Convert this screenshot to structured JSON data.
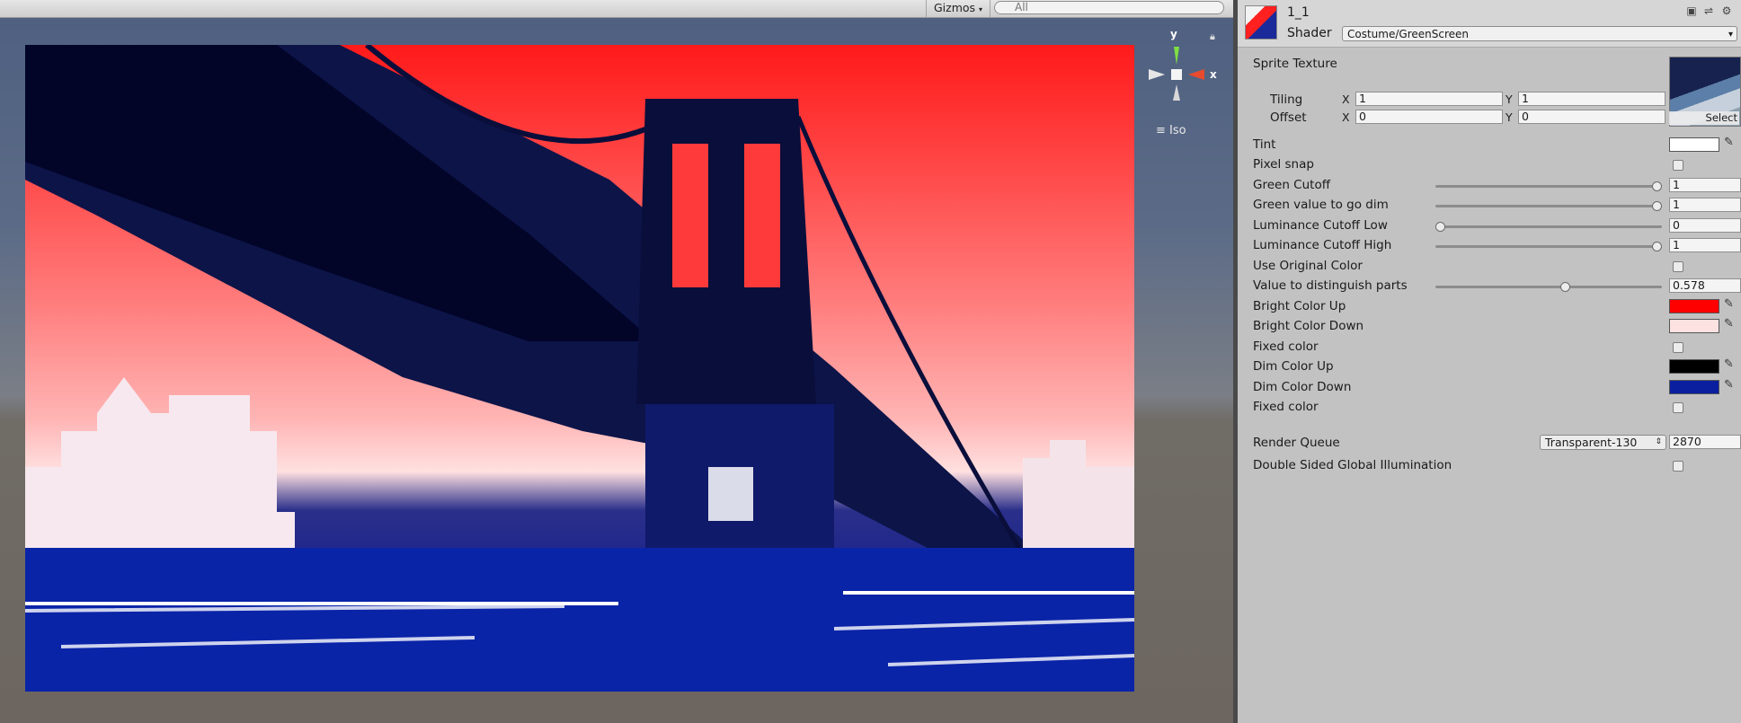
{
  "scene": {
    "gizmos_label": "Gizmos",
    "search_placeholder": "All",
    "axis_y": "y",
    "axis_x": "x",
    "iso_label": "Iso"
  },
  "inspector": {
    "material_name": "1_1",
    "shader_label": "Shader",
    "shader_value": "Costume/GreenScreen",
    "sprite_texture_label": "Sprite Texture",
    "texture_select_label": "Select",
    "tiling": {
      "label": "Tiling",
      "x_label": "X",
      "y_label": "Y",
      "x": "1",
      "y": "1"
    },
    "offset": {
      "label": "Offset",
      "x_label": "X",
      "y_label": "Y",
      "x": "0",
      "y": "0"
    },
    "tint_label": "Tint",
    "pixel_snap_label": "Pixel snap",
    "sliders": [
      {
        "label": "Green Cutoff",
        "value": "1",
        "fraction": 1.0
      },
      {
        "label": "Green value to go dim",
        "value": "1",
        "fraction": 1.0
      },
      {
        "label": "Luminance Cutoff Low",
        "value": "0",
        "fraction": 0.0
      },
      {
        "label": "Luminance Cutoff High",
        "value": "1",
        "fraction": 1.0
      }
    ],
    "use_original_color_label": "Use Original Color",
    "distinguish": {
      "label": "Value to distinguish parts",
      "value": "0.578",
      "fraction": 0.578
    },
    "bright_color_up_label": "Bright Color Up",
    "bright_color_down_label": "Bright Color Down",
    "fixed_color_1_label": "Fixed color",
    "dim_color_up_label": "Dim Color Up",
    "dim_color_down_label": "Dim Color Down",
    "fixed_color_2_label": "Fixed color",
    "render_queue_label": "Render Queue",
    "render_queue_option": "Transparent-130",
    "render_queue_value": "2870",
    "double_sided_gi_label": "Double Sided Global Illumination"
  },
  "colors": {
    "tint": "#ffffff",
    "bright_color_up": "#ff0000",
    "bright_color_down": "#fde2e2",
    "dim_color_up": "#000000",
    "dim_color_down": "#0a1fa0"
  }
}
